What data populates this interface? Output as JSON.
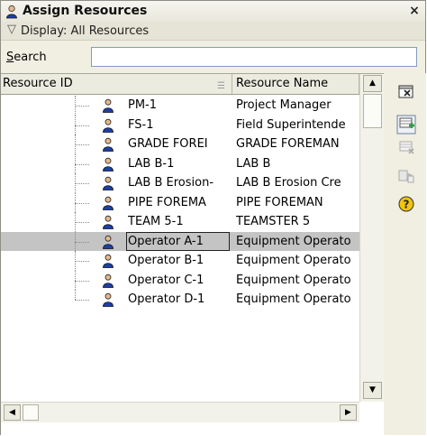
{
  "window": {
    "title": "Assign Resources",
    "close_glyph": "×"
  },
  "display": {
    "chevron": "▽",
    "text": "Display: All Resources"
  },
  "search": {
    "label_first": "S",
    "label_rest": "earch",
    "value": "",
    "placeholder": ""
  },
  "grid": {
    "columns": [
      "Resource ID",
      "Resource Name"
    ],
    "rows": [
      {
        "id": "PM-1",
        "name": "Project Manager",
        "selected": false
      },
      {
        "id": "FS-1",
        "name": "Field Superintende",
        "selected": false
      },
      {
        "id": "GRADE FOREI",
        "name": "GRADE FOREMAN",
        "selected": false
      },
      {
        "id": "LAB B-1",
        "name": "LAB B",
        "selected": false
      },
      {
        "id": "LAB B Erosion-",
        "name": "LAB B Erosion Cre",
        "selected": false
      },
      {
        "id": "PIPE FOREMA",
        "name": "PIPE FOREMAN",
        "selected": false
      },
      {
        "id": "TEAM 5-1",
        "name": "TEAMSTER 5",
        "selected": false
      },
      {
        "id": "Operator A-1",
        "name": "Equipment Operato",
        "selected": true
      },
      {
        "id": "Operator B-1",
        "name": "Equipment Operato",
        "selected": false
      },
      {
        "id": "Operator C-1",
        "name": "Equipment Operato",
        "selected": false
      },
      {
        "id": "Operator D-1",
        "name": "Equipment Operato",
        "selected": false
      }
    ]
  },
  "toolbar": {
    "items": [
      "close-panel-icon",
      "assign-resource-icon",
      "unassign-resource-icon",
      "replace-resource-icon",
      "help-icon"
    ]
  },
  "colors": {
    "person_icon": "#1c3fa8",
    "help_icon": "#f1c40f",
    "assign_icon": "#2e9e3a"
  }
}
